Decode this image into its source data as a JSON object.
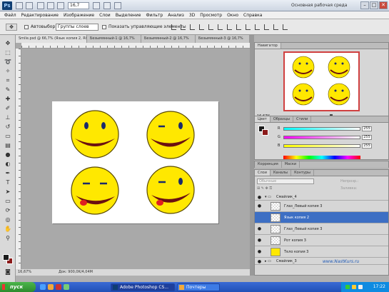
{
  "appbar": {
    "logo": "Ps",
    "zoom": "16,7",
    "workspace": "Основная рабочая среда",
    "controls": [
      "–",
      "□",
      "✕"
    ]
  },
  "menu": [
    "Файл",
    "Редактирование",
    "Изображение",
    "Слои",
    "Выделение",
    "Фильтр",
    "Анализ",
    "3D",
    "Просмотр",
    "Окно",
    "Справка"
  ],
  "options": {
    "autoselect_label": "Автовыбор:",
    "autoselect_value": "Группы слоев",
    "show_controls_label": "Показать управляющие элементы"
  },
  "document": {
    "tabs": [
      "Smile.psd @ 66,7% (Язык копия 2, RGB/8)",
      "Безымянный-1 @ 16,7%",
      "Безымянный-2 @ 16,7%",
      "Безымянный-3 @ 16,7%"
    ],
    "zoom": "16,67%",
    "doc_info": "Док: 900,0K/4,04M"
  },
  "navigator": {
    "tabs": [
      "Навигатор"
    ],
    "zoom": "16,67%"
  },
  "color": {
    "tabs": [
      "Цвет",
      "Образцы",
      "Стили"
    ],
    "channels": [
      {
        "label": "R",
        "value": "255",
        "gradient": "#ff0000"
      },
      {
        "label": "G",
        "value": "255",
        "gradient": "#00ff00"
      },
      {
        "label": "B",
        "value": "255",
        "gradient": "#0000ff"
      }
    ]
  },
  "adjust": {
    "tabs": [
      "Коррекция",
      "Маски"
    ]
  },
  "layers": {
    "tabs": [
      "Слои",
      "Каналы",
      "Контуры"
    ],
    "blend_mode": "Обычные",
    "opacity_label": "Непрозр.:",
    "fill_label": "Заливка:",
    "group_name": "Смайлик_4",
    "items": [
      {
        "name": "Глаз_Левый копия 3",
        "selected": false
      },
      {
        "name": "Язык копия 2",
        "selected": true
      },
      {
        "name": "Глаз_Левый копия 3",
        "selected": false
      },
      {
        "name": "Рот копия 3",
        "selected": false
      },
      {
        "name": "Тело копия 3",
        "selected": false
      }
    ],
    "group_bottom": "Смайлик_3",
    "watermark": "www.NastKurs.ru"
  },
  "taskbar": {
    "start": "пуск",
    "tasks": [
      {
        "label": "Adobe Photoshop CS...",
        "active": true
      },
      {
        "label": "Почтеры",
        "active": false
      }
    ],
    "clock": "17:22"
  },
  "colors": {
    "smile_fill": "#ffe800",
    "eye": "#1a2a6b",
    "mouth": "#6b1111",
    "tongue": "#e02020"
  }
}
